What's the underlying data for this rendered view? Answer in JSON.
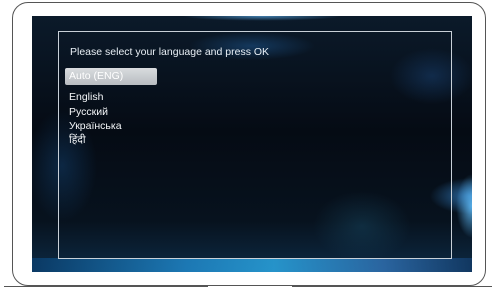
{
  "menu": {
    "title": "Please select your language and press OK",
    "languages": [
      {
        "label": "Auto (ENG)",
        "selected": true
      },
      {
        "label": "English",
        "selected": false
      },
      {
        "label": "Русский",
        "selected": false
      },
      {
        "label": "Українська",
        "selected": false
      },
      {
        "label": "हिंदी",
        "selected": false
      }
    ]
  },
  "colors": {
    "screen_background": "#050b14",
    "frame_border": "#c8d0d8",
    "highlight": "#c8ccd0",
    "text": "#f4f6f8",
    "accent_glow": "#2aa6e2"
  }
}
